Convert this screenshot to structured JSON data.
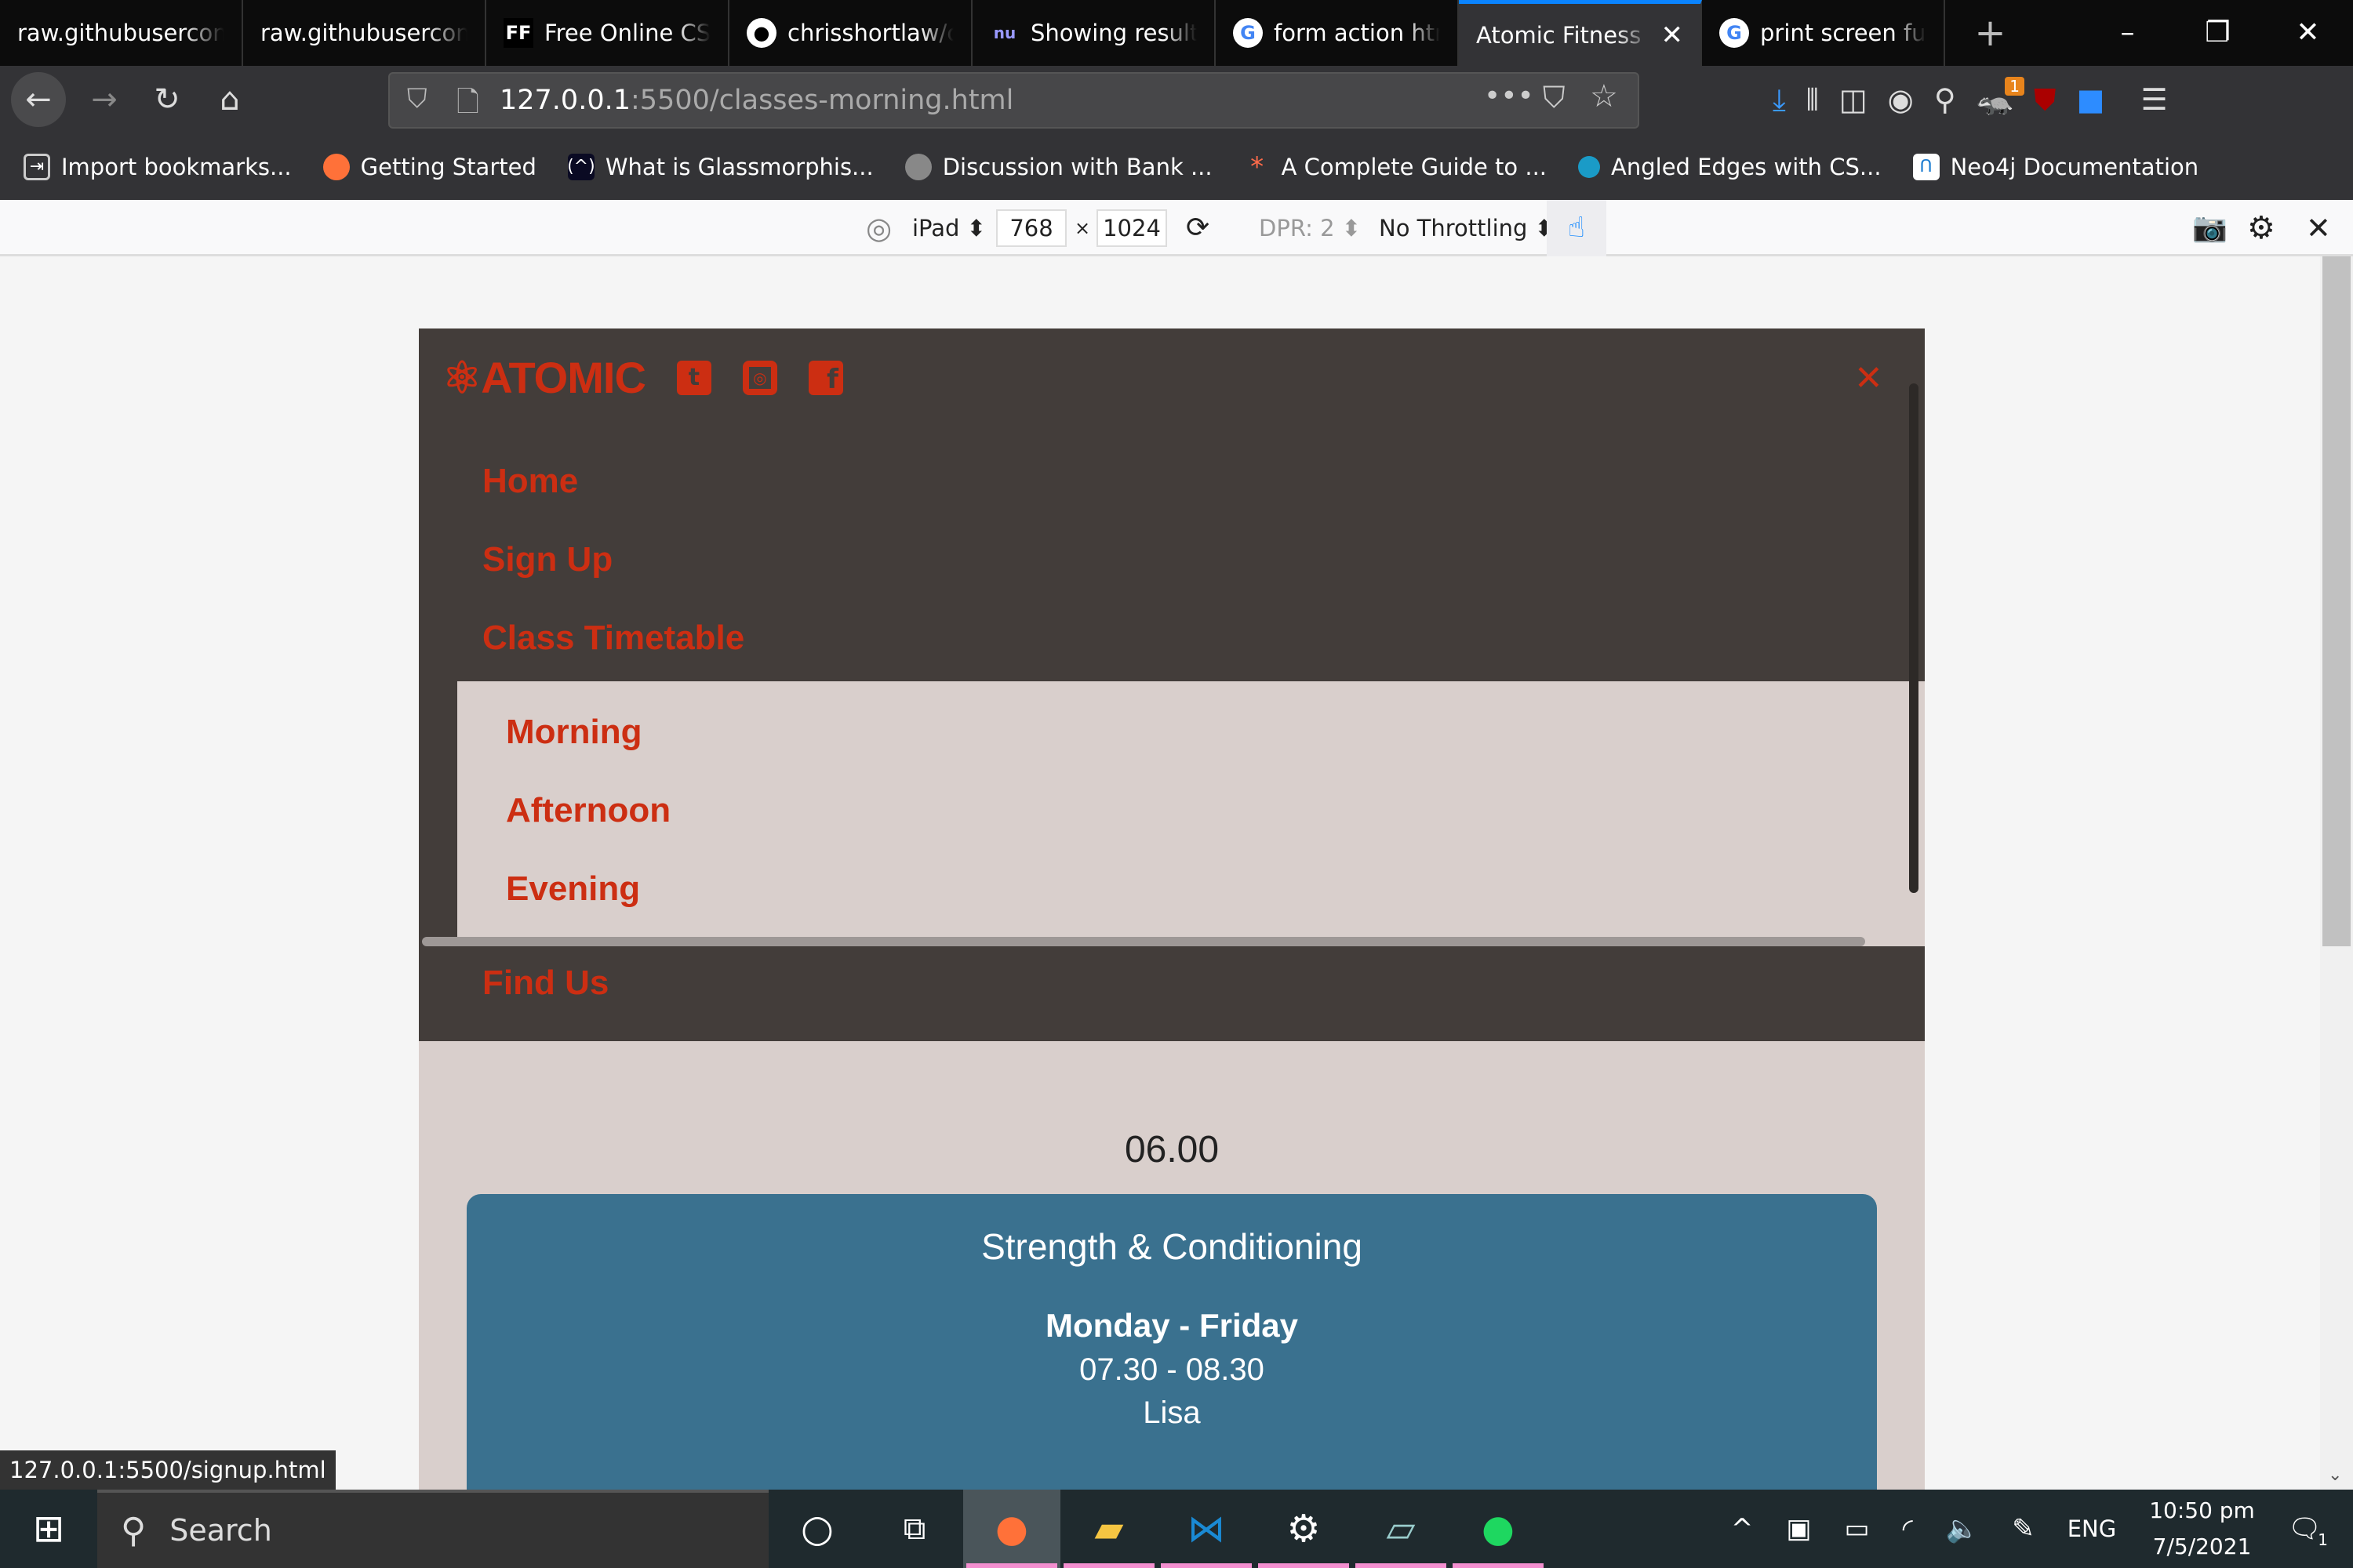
{
  "browser": {
    "tabs": [
      {
        "title": "raw.githubusercontent",
        "icon": "none"
      },
      {
        "title": "raw.githubusercontent",
        "icon": "none"
      },
      {
        "title": "Free Online CSS",
        "icon": "ff-icon"
      },
      {
        "title": "chrisshortlaw/c",
        "icon": "github-icon"
      },
      {
        "title": "Showing results",
        "icon": "nu-icon"
      },
      {
        "title": "form action htm",
        "icon": "google-icon"
      },
      {
        "title": "Atomic Fitness |",
        "icon": "none",
        "active": true
      },
      {
        "title": "print screen fun",
        "icon": "google-icon"
      }
    ],
    "url_host": "127.0.0.1",
    "url_path": ":5500/classes-morning.html",
    "bookmarks": [
      {
        "label": "Import bookmarks...",
        "icon": "import-icon"
      },
      {
        "label": "Getting Started",
        "icon": "firefox-icon"
      },
      {
        "label": "What is Glassmorphis...",
        "icon": "bookmark-site-icon"
      },
      {
        "label": "Discussion with Bank ...",
        "icon": "bookmark-site-icon"
      },
      {
        "label": "A Complete Guide to ...",
        "icon": "bookmark-site-icon"
      },
      {
        "label": "Angled Edges with CS...",
        "icon": "bookmark-site-icon"
      },
      {
        "label": "Neo4j Documentation",
        "icon": "neo4j-icon"
      }
    ],
    "extension_badge": "1",
    "status_url": "127.0.0.1:5500/signup.html"
  },
  "rdm": {
    "device": "iPad",
    "width": "768",
    "times": "×",
    "height": "1024",
    "dpr": "DPR: 2",
    "throttling": "No Throttling"
  },
  "site": {
    "logo": "ATOMIC",
    "accent": "#cc2e12",
    "nav": [
      "Home",
      "Sign Up",
      "Class Timetable",
      "Find Us"
    ],
    "submenu": [
      "Morning",
      "Afternoon",
      "Evening"
    ],
    "time": "06.00",
    "card": {
      "title": "Strength & Conditioning",
      "days": "Monday - Friday",
      "hours": "07.30 - 08.30",
      "instructor": "Lisa"
    }
  },
  "taskbar": {
    "search": "Search",
    "lang": "ENG",
    "clock_time": "10:50 pm",
    "clock_date": "7/5/2021",
    "notifications": "1"
  }
}
